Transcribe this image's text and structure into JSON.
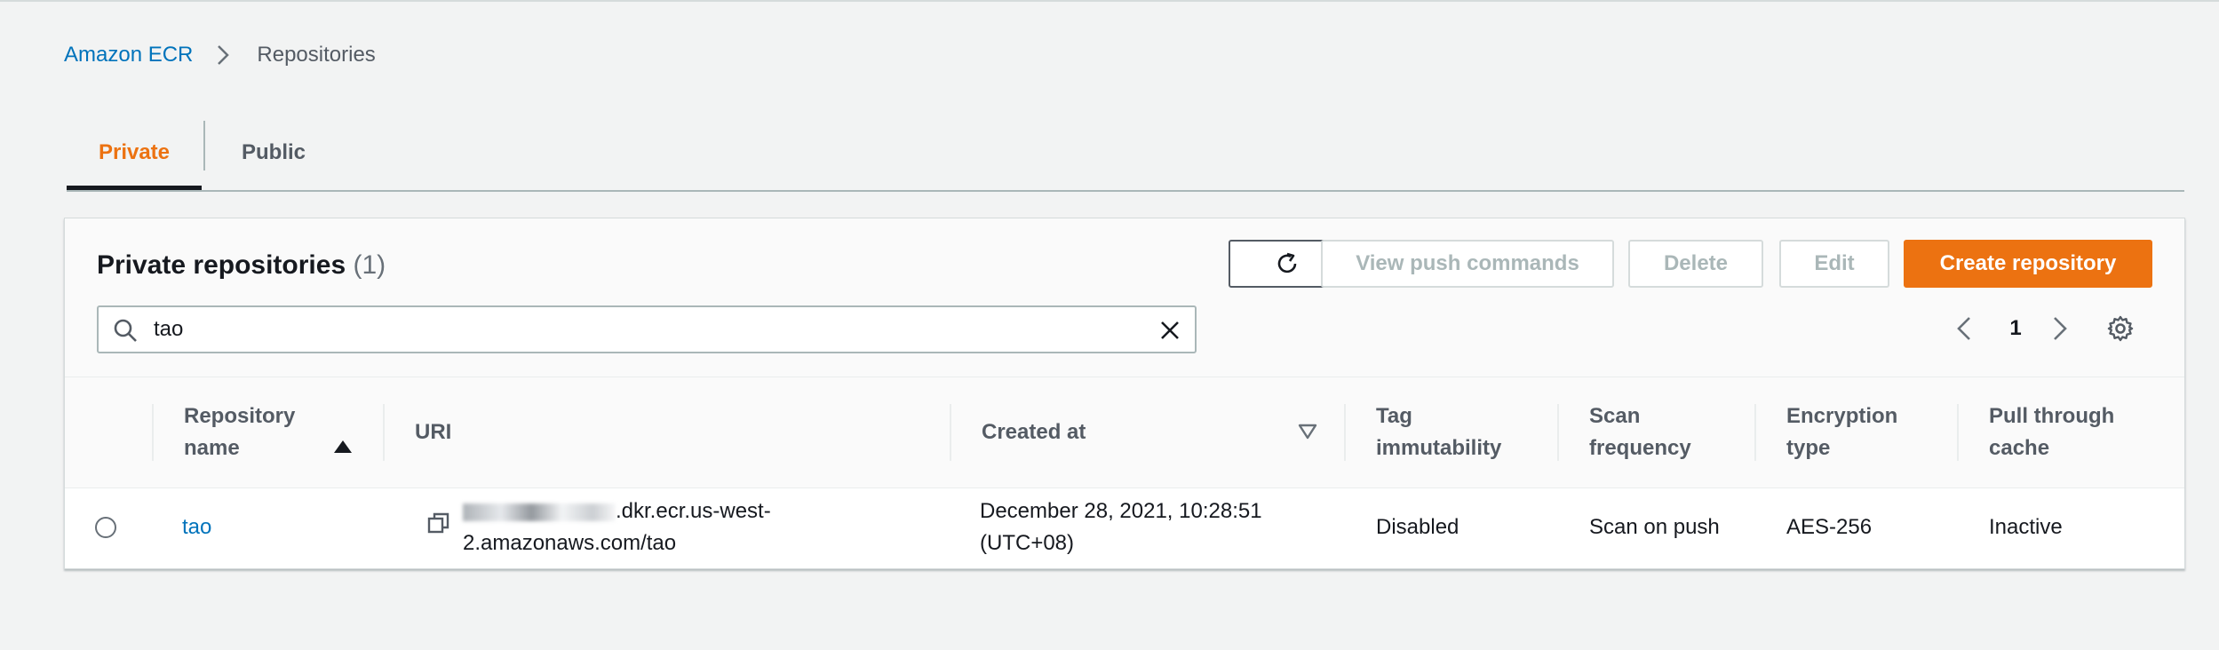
{
  "breadcrumb": {
    "root": "Amazon ECR",
    "current": "Repositories"
  },
  "tabs": [
    {
      "label": "Private",
      "active": true
    },
    {
      "label": "Public",
      "active": false
    }
  ],
  "panel": {
    "title": "Private repositories",
    "count": "(1)",
    "buttons": {
      "refresh_icon": "refresh-icon",
      "view_push_commands": "View push commands",
      "delete": "Delete",
      "edit": "Edit",
      "create_repository": "Create repository"
    },
    "search": {
      "value": "tao"
    },
    "pagination": {
      "current_page": "1"
    }
  },
  "table": {
    "columns": [
      "Repository\nname",
      "URI",
      "Created at",
      "Tag\nimmutability",
      "Scan\nfrequency",
      "Encryption\ntype",
      "Pull through\ncache"
    ],
    "sorted_column": "Repository name",
    "sort_direction": "ascending",
    "rows": [
      {
        "repository_name": "tao",
        "uri_visible": ".dkr.ecr.us-west-2.amazonaws.com/tao",
        "uri_line1": ".dkr.ecr.us-west-",
        "uri_line2": "2.amazonaws.com/tao",
        "created_at_line1": "December 28, 2021, 10:28:51",
        "created_at_line2": "(UTC+08)",
        "tag_immutability": "Disabled",
        "scan_frequency": "Scan on push",
        "encryption_type": "AES-256",
        "pull_through_cache": "Inactive"
      }
    ]
  },
  "colors": {
    "accent": "#ec7211",
    "link": "#0073bb",
    "text": "#16191f",
    "muted": "#545b64",
    "background": "#f2f3f3"
  }
}
